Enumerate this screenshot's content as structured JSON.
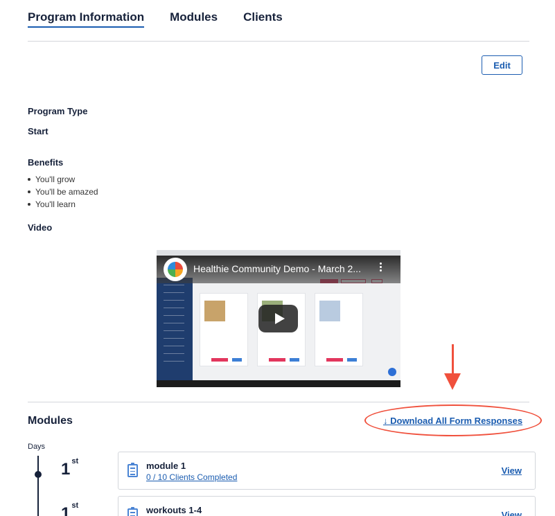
{
  "tabs": [
    {
      "label": "Program Information",
      "active": true
    },
    {
      "label": "Modules",
      "active": false
    },
    {
      "label": "Clients",
      "active": false
    }
  ],
  "edit_label": "Edit",
  "program_type": {
    "label": "Program Type",
    "value": "Start"
  },
  "benefits": {
    "label": "Benefits",
    "items": [
      "You'll grow",
      "You'll be amazed",
      "You'll learn"
    ]
  },
  "video": {
    "label": "Video",
    "title": "Healthie Community Demo - March 2..."
  },
  "modules_section": {
    "title": "Modules",
    "download_label": "↓ Download All Form Responses",
    "days_label": "Days",
    "items": [
      {
        "day": "1",
        "suffix": "st",
        "title": "module 1",
        "progress": "0 / 10 Clients Completed",
        "view": "View"
      },
      {
        "day": "1",
        "suffix": "st",
        "title": "workouts 1-4",
        "progress": "",
        "view": "View"
      }
    ]
  },
  "colors": {
    "accent": "#1a5cb0",
    "annotation": "#f0503c",
    "text": "#16213a"
  }
}
